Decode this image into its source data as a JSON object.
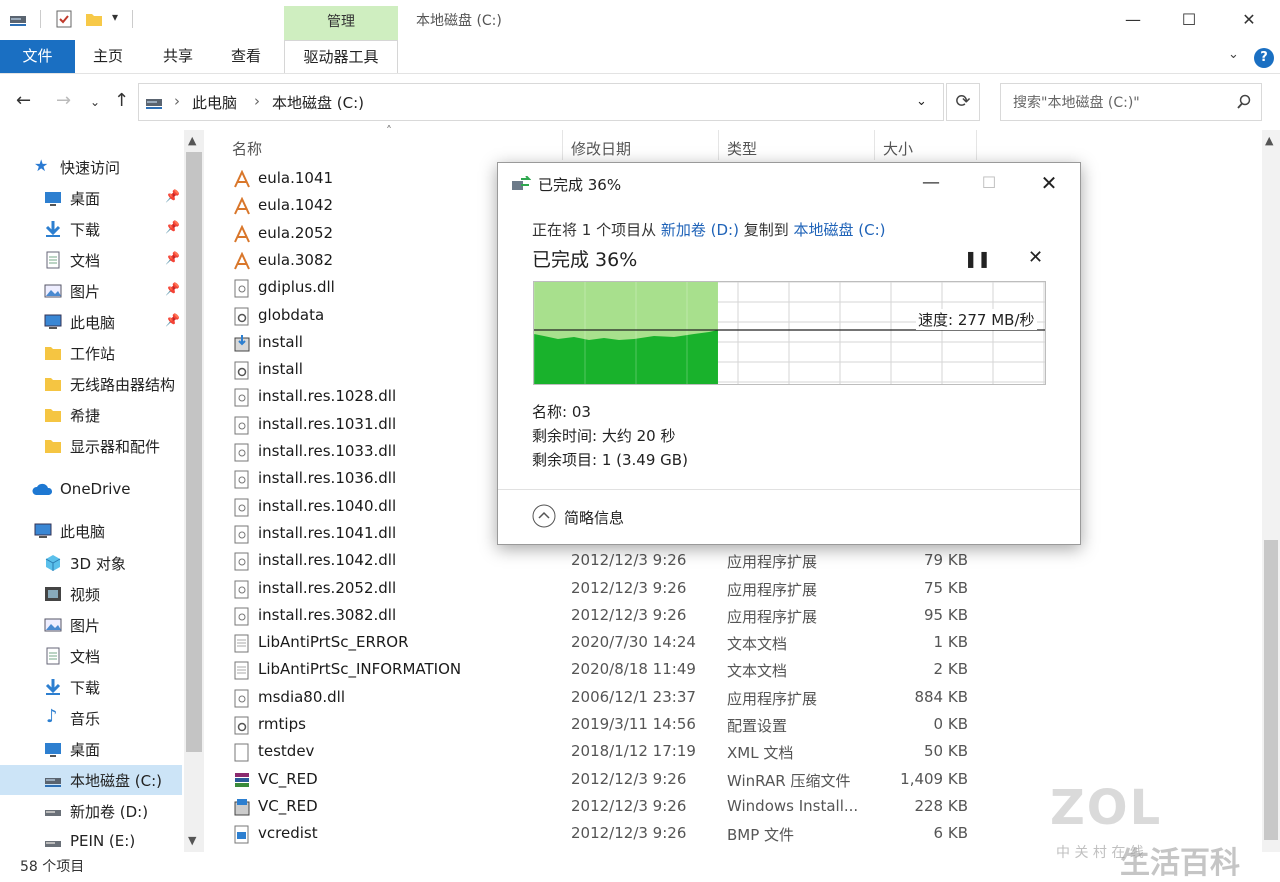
{
  "window": {
    "title": "本地磁盘 (C:)",
    "context_tab": "管理",
    "minimize": "—",
    "maximize": "☐",
    "close": "✕"
  },
  "ribbon": {
    "tabs": [
      "文件",
      "主页",
      "共享",
      "查看",
      "驱动器工具"
    ],
    "help": "?"
  },
  "address": {
    "crumbs": [
      "此电脑",
      "本地磁盘 (C:)"
    ],
    "search_placeholder": "搜索\"本地磁盘 (C:)\""
  },
  "sidebar": {
    "quick_access": "快速访问",
    "quick_items": [
      "桌面",
      "下载",
      "文档",
      "图片",
      "此电脑",
      "工作站",
      "无线路由器结构",
      "希捷",
      "显示器和配件"
    ],
    "onedrive": "OneDrive",
    "this_pc": "此电脑",
    "pc_items": [
      "3D 对象",
      "视频",
      "图片",
      "文档",
      "下载",
      "音乐",
      "桌面",
      "本地磁盘 (C:)",
      "新加卷 (D:)",
      "PEIN (E:)"
    ]
  },
  "columns": {
    "name": "名称",
    "date": "修改日期",
    "type": "类型",
    "size": "大小"
  },
  "files": [
    {
      "name": "eula.1041",
      "date": "",
      "type": "",
      "size": "",
      "icon": "txt-icon-orange"
    },
    {
      "name": "eula.1042",
      "date": "",
      "type": "",
      "size": "",
      "icon": "txt-icon-orange"
    },
    {
      "name": "eula.2052",
      "date": "",
      "type": "",
      "size": "",
      "icon": "txt-icon-orange"
    },
    {
      "name": "eula.3082",
      "date": "",
      "type": "",
      "size": "",
      "icon": "txt-icon-orange"
    },
    {
      "name": "gdiplus.dll",
      "date": "",
      "type": "",
      "size": "",
      "icon": "dll-icon"
    },
    {
      "name": "globdata",
      "date": "",
      "type": "",
      "size": "",
      "icon": "settings-file-icon"
    },
    {
      "name": "install",
      "date": "",
      "type": "",
      "size": "",
      "icon": "installer-icon"
    },
    {
      "name": "install",
      "date": "",
      "type": "",
      "size": "",
      "icon": "settings-file-icon"
    },
    {
      "name": "install.res.1028.dll",
      "date": "",
      "type": "",
      "size": "",
      "icon": "dll-icon"
    },
    {
      "name": "install.res.1031.dll",
      "date": "",
      "type": "",
      "size": "",
      "icon": "dll-icon"
    },
    {
      "name": "install.res.1033.dll",
      "date": "",
      "type": "",
      "size": "",
      "icon": "dll-icon"
    },
    {
      "name": "install.res.1036.dll",
      "date": "",
      "type": "",
      "size": "",
      "icon": "dll-icon"
    },
    {
      "name": "install.res.1040.dll",
      "date": "",
      "type": "",
      "size": "",
      "icon": "dll-icon"
    },
    {
      "name": "install.res.1041.dll",
      "date": "",
      "type": "",
      "size": "",
      "icon": "dll-icon"
    },
    {
      "name": "install.res.1042.dll",
      "date": "2012/12/3 9:26",
      "type": "应用程序扩展",
      "size": "79 KB",
      "icon": "dll-icon"
    },
    {
      "name": "install.res.2052.dll",
      "date": "2012/12/3 9:26",
      "type": "应用程序扩展",
      "size": "75 KB",
      "icon": "dll-icon"
    },
    {
      "name": "install.res.3082.dll",
      "date": "2012/12/3 9:26",
      "type": "应用程序扩展",
      "size": "95 KB",
      "icon": "dll-icon"
    },
    {
      "name": "LibAntiPrtSc_ERROR",
      "date": "2020/7/30 14:24",
      "type": "文本文档",
      "size": "1 KB",
      "icon": "text-doc-icon"
    },
    {
      "name": "LibAntiPrtSc_INFORMATION",
      "date": "2020/8/18 11:49",
      "type": "文本文档",
      "size": "2 KB",
      "icon": "text-doc-icon"
    },
    {
      "name": "msdia80.dll",
      "date": "2006/12/1 23:37",
      "type": "应用程序扩展",
      "size": "884 KB",
      "icon": "dll-icon"
    },
    {
      "name": "rmtips",
      "date": "2019/3/11 14:56",
      "type": "配置设置",
      "size": "0 KB",
      "icon": "settings-file-icon"
    },
    {
      "name": "testdev",
      "date": "2018/1/12 17:19",
      "type": "XML 文档",
      "size": "50 KB",
      "icon": "xml-doc-icon"
    },
    {
      "name": "VC_RED",
      "date": "2012/12/3 9:26",
      "type": "WinRAR 压缩文件",
      "size": "1,409 KB",
      "icon": "winrar-icon"
    },
    {
      "name": "VC_RED",
      "date": "2012/12/3 9:26",
      "type": "Windows Install...",
      "size": "228 KB",
      "icon": "msi-icon"
    },
    {
      "name": "vcredist",
      "date": "2012/12/3 9:26",
      "type": "BMP 文件",
      "size": "6 KB",
      "icon": "bmp-icon"
    }
  ],
  "status": {
    "count": "58 个项目"
  },
  "dialog": {
    "title": "已完成 36%",
    "sub_prefix": "正在将 1 个项目从",
    "source": "新加卷 (D:)",
    "sub_mid": "复制到",
    "dest": "本地磁盘 (C:)",
    "big": "已完成 36%",
    "progress": 0.36,
    "speed": "速度: 277 MB/秒",
    "name_line": "名称: 03",
    "time_line": "剩余时间: 大约 20 秒",
    "items_line": "剩余项目: 1 (3.49 GB)",
    "less_info": "简略信息",
    "colors": {
      "fill_light": "#a8e08d",
      "fill_dark": "#19b22c",
      "link": "#1f63b8"
    }
  },
  "watermark": {
    "logo": "ZOL",
    "sub": "中 关 村 在 线",
    "tag": "生活百科"
  }
}
